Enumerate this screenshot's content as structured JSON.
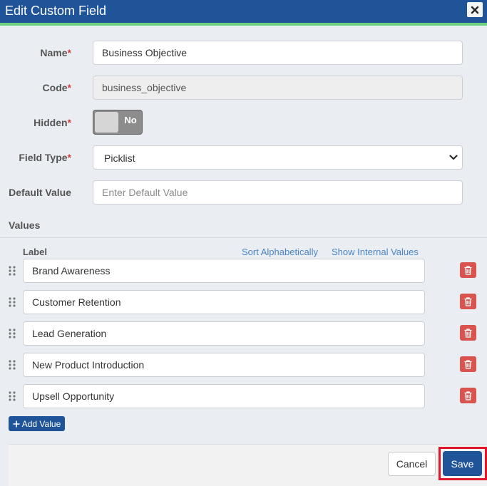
{
  "dialog": {
    "title": "Edit Custom Field",
    "close_icon": "close-icon"
  },
  "form": {
    "name": {
      "label": "Name",
      "required_mark": "*",
      "value": "Business Objective"
    },
    "code": {
      "label": "Code",
      "required_mark": "*",
      "value": "business_objective"
    },
    "hidden": {
      "label": "Hidden",
      "required_mark": "*",
      "toggle_text": "No",
      "state": false
    },
    "field_type": {
      "label": "Field Type",
      "required_mark": "*",
      "selected": "Picklist"
    },
    "default_value": {
      "label": "Default Value",
      "value": "",
      "placeholder": "Enter Default Value"
    }
  },
  "values_section": {
    "title": "Values",
    "column_label": "Label",
    "sort_link": "Sort Alphabetically",
    "internal_link": "Show Internal Values",
    "items": [
      {
        "label": "Brand Awareness"
      },
      {
        "label": "Customer Retention"
      },
      {
        "label": "Lead Generation"
      },
      {
        "label": "New Product Introduction"
      },
      {
        "label": "Upsell Opportunity"
      }
    ],
    "add_button": "Add Value"
  },
  "footer": {
    "cancel": "Cancel",
    "save": "Save"
  },
  "colors": {
    "header": "#1f5499",
    "accent": "#6fd17d",
    "delete": "#d9534f",
    "highlight": "#e0162b"
  }
}
